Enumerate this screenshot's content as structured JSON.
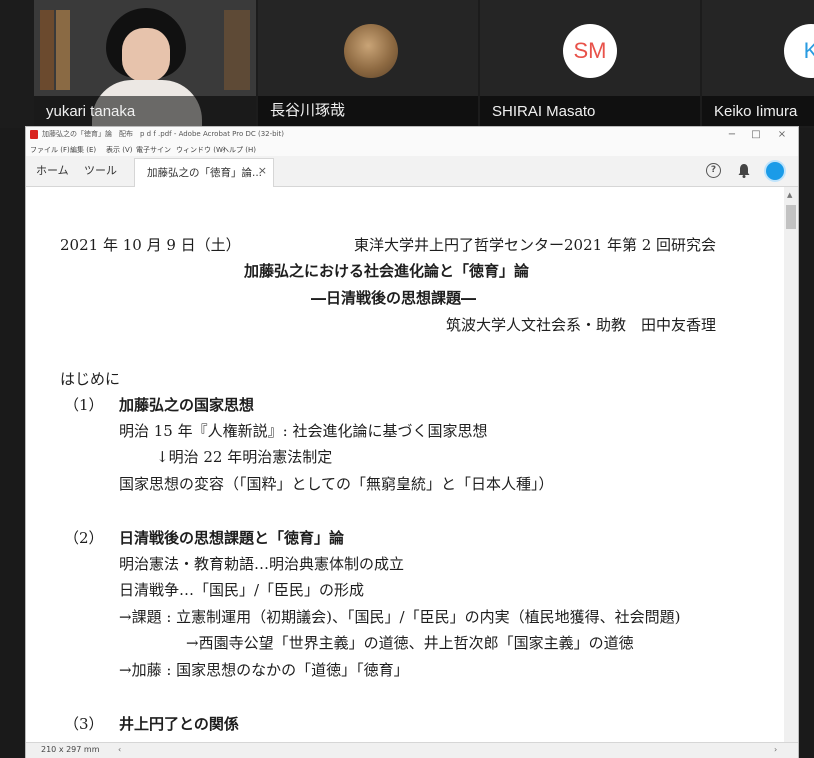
{
  "participants": [
    {
      "name": "yukari tanaka",
      "video": true
    },
    {
      "name": "長谷川琢哉",
      "avatar": "photo"
    },
    {
      "name": "SHIRAI Masato",
      "initials": "SM"
    },
    {
      "name": "Keiko Iimura",
      "initials": "K"
    }
  ],
  "window": {
    "title": "加藤弘之の「徳育」論　配布　p d f .pdf - Adobe Acrobat Pro DC (32-bit)",
    "controls": {
      "minimize": "−",
      "maximize": "□",
      "close": "×"
    },
    "menu": [
      "ファイル (F)",
      "編集 (E)",
      "表示 (V)",
      "電子サイン",
      "ウィンドウ (W)",
      "ヘルプ (H)"
    ],
    "tabs": {
      "home": "ホーム",
      "tools": "ツール",
      "document": "加藤弘之の「徳育」論...",
      "close": "×"
    },
    "icons": {
      "help": "?",
      "bell": "bell-icon",
      "account": "user-icon"
    },
    "accent_color": "#1a9be8",
    "status": {
      "page_size": "210 x 297 mm",
      "left_arrow": "‹",
      "right_arrow": "›"
    }
  },
  "document": {
    "date": "2021 年 10 月 9 日（土）",
    "event": "東洋大学井上円了哲学センター2021 年第 2 回研究会",
    "title": "加藤弘之における社会進化論と「徳育」論",
    "subtitle": "―日清戦後の思想課題―",
    "author": "筑波大学人文社会系・助教　田中友香理",
    "intro": "はじめに",
    "sections": [
      {
        "num": "（1）",
        "heading": "加藤弘之の国家思想",
        "lines": [
          "明治 15 年『人権新説』: 社会進化論に基づく国家思想",
          "↓明治 22 年明治憲法制定",
          "国家思想の変容（「国粋」としての「無窮皇統」と「日本人種」）"
        ]
      },
      {
        "num": "（2）",
        "heading": "日清戦後の思想課題と「徳育」論",
        "lines": [
          "明治憲法・教育勅語…明治典憲体制の成立",
          "日清戦争…「国民」/「臣民」の形成",
          "→課題 : 立憲制運用（初期議会)、「国民」/「臣民」の内実（植民地獲得、社会問題)",
          "→西園寺公望「世界主義」の道徳、井上哲次郎「国家主義」の道徳",
          "→加藤 : 国家思想のなかの「道徳」「徳育」"
        ]
      },
      {
        "num": "（3）",
        "heading": "井上円了との関係",
        "lines": []
      }
    ]
  }
}
